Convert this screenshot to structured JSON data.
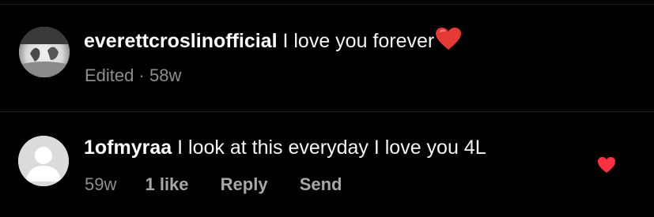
{
  "comments": [
    {
      "username": "everettcroslinofficial",
      "text": "I love you forever",
      "emoji": "red-heart",
      "edited_label": "Edited",
      "separator": "·",
      "age": "58w"
    },
    {
      "username": "1ofmyraa",
      "text": "I look at this everyday I love you 4L",
      "age": "59w",
      "likes": "1 like",
      "reply_label": "Reply",
      "send_label": "Send",
      "liked": true
    }
  ],
  "colors": {
    "background": "#000000",
    "text": "#f5f5f5",
    "meta": "#8e8e8e",
    "heart": "#ff3040",
    "emoji_heart": "#e53935"
  }
}
